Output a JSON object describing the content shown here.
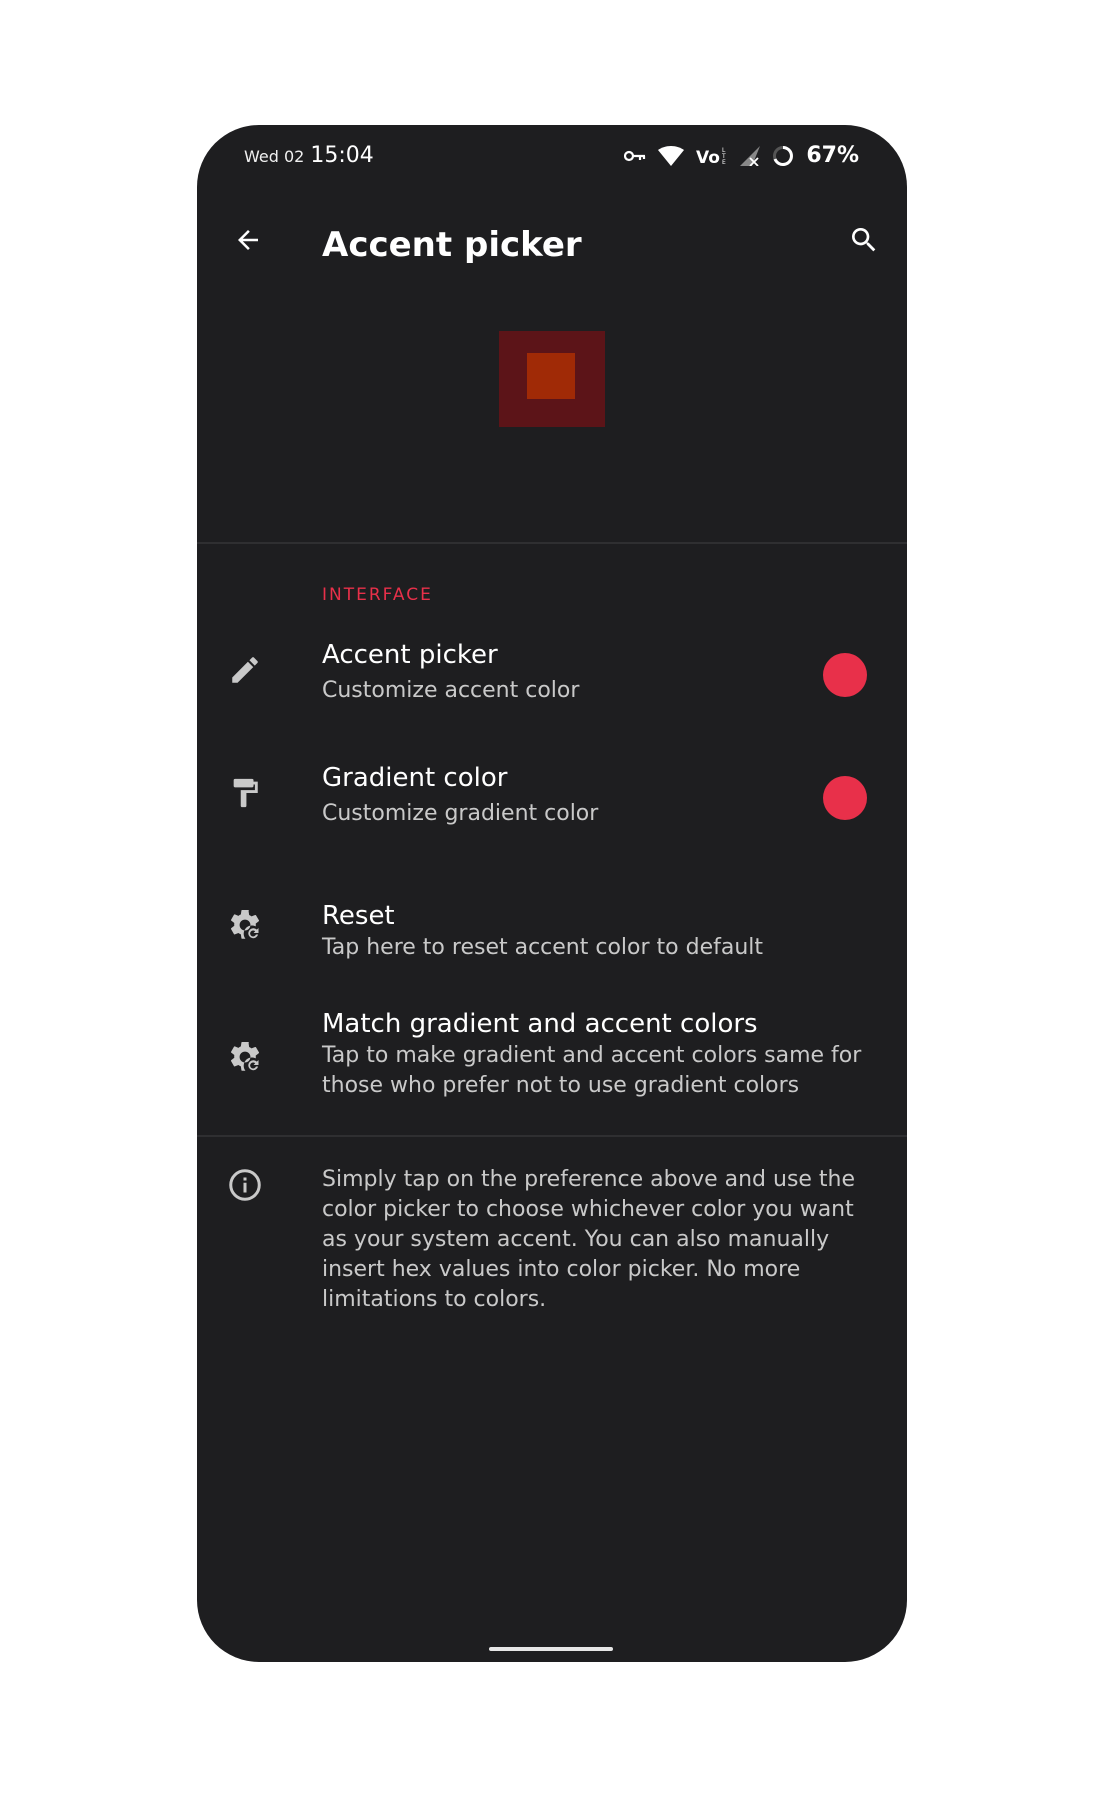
{
  "status_bar": {
    "date": "Wed 02",
    "time": "15:04",
    "battery": "67%",
    "icons": [
      "vpn-key-icon",
      "wifi-icon",
      "volte-icon",
      "signal-icon",
      "battery-ring-icon"
    ]
  },
  "app_bar": {
    "title": "Accent picker",
    "back_icon": "arrow-back-icon",
    "search_icon": "search-icon"
  },
  "preview": {
    "outer_color": "#5c1418",
    "inner_color": "#a02a06"
  },
  "section": {
    "header": "INTERFACE"
  },
  "preferences": [
    {
      "icon": "pencil-icon",
      "title": "Accent picker",
      "summary": "Customize accent color",
      "color": "#e8304a"
    },
    {
      "icon": "paint-roller-icon",
      "title": "Gradient color",
      "summary": "Customize gradient color",
      "color": "#e8304a"
    },
    {
      "icon": "settings-reset-icon",
      "title": "Reset",
      "summary": "Tap here to reset accent color to default"
    },
    {
      "icon": "settings-reset-icon",
      "title": "Match gradient and accent colors",
      "summary": "Tap to make gradient and accent colors same for those who prefer not to use gradient colors"
    }
  ],
  "info": {
    "icon": "info-icon",
    "text": "Simply tap on the preference above and use the color picker to choose whichever color you want as your system accent. You can also manually insert hex values into color picker. No more limitations to colors."
  },
  "theme": {
    "background": "#1e1e20",
    "accent": "#e8304a",
    "text_primary": "#ffffff",
    "text_secondary": "#c9c9c9"
  }
}
